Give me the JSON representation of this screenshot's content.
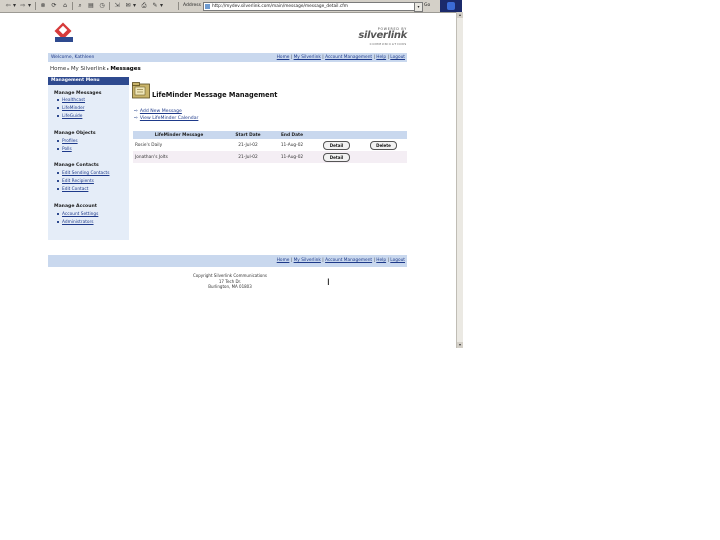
{
  "browser": {
    "toolbar_buttons": [
      "⇦",
      "▾",
      "⇨",
      "▾",
      "⊗",
      "⟳",
      "⌂",
      "⌕",
      "▤",
      "◷",
      "⇲",
      "✉",
      "▾",
      "⎙",
      "✎",
      "▾"
    ],
    "address_label": "Address",
    "url": "http://mydev.silverlink.com/main/message/message_detail.cfm",
    "go_label": "Go"
  },
  "header": {
    "powered_by": "POWERED BY",
    "brand": "silverlink",
    "brand_sub": "COMMUNICATIONS"
  },
  "topbar": {
    "welcome": "Welcome, Kathleen",
    "nav": [
      "Home",
      "My Silverlink",
      "Account Management",
      "Help",
      "Logout"
    ]
  },
  "breadcrumb": {
    "home": "Home",
    "mysilverlink": "My Silverlink",
    "current": "Messages"
  },
  "sidebar": {
    "title": "Management Menu",
    "sections": [
      {
        "heading": "Manage Messages",
        "items": [
          "Healthcast",
          "LifeMinder",
          "LifeGuide"
        ]
      },
      {
        "heading": "Manage Objects",
        "items": [
          "Profiles",
          "Polls"
        ]
      },
      {
        "heading": "Manage Contacts",
        "items": [
          "Edit Sending Contacts",
          "Edit Recipients",
          "Edit Contact"
        ]
      },
      {
        "heading": "Manage Account",
        "items": [
          "Account Settings",
          "Administrators"
        ]
      }
    ]
  },
  "main": {
    "title": "LifeMinder Message Management",
    "actions": [
      "Add New Message",
      "View LifeMinder Calendar"
    ],
    "table": {
      "columns": [
        "LifeMinder Message",
        "Start Date",
        "End Date"
      ],
      "rows": [
        {
          "message": "Rosie's Daily",
          "start": "21-Jul-02",
          "end": "11-Aug-02",
          "detail": "Detail",
          "delete": "Delete"
        },
        {
          "message": "Jonathan's Jolts",
          "start": "21-Jul-02",
          "end": "11-Aug-02",
          "detail": "Detail"
        }
      ]
    }
  },
  "footer": {
    "nav": [
      "Home",
      "My Silverlink",
      "Account Management",
      "Help",
      "Logout"
    ],
    "copyright": [
      "Copyright Silverlink Communications",
      "17 Tech Dr.",
      "Burlington, MA 01803"
    ]
  },
  "colors": {
    "accent_blue": "#2e4a8f",
    "bar_bg": "#c9d8ee",
    "sidebar_bg": "#e5edf8",
    "logo_red": "#d63a3a"
  }
}
